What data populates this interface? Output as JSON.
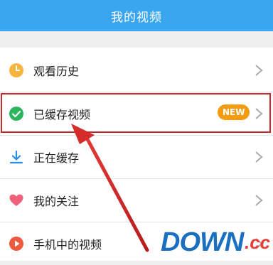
{
  "header": {
    "title": "我的视频"
  },
  "items": [
    {
      "label": "观看历史",
      "icon": "clock-icon",
      "color": "#f5b53f"
    },
    {
      "label": "已缓存视频",
      "icon": "check-circle-icon",
      "color": "#2db55d",
      "badge": "NEW",
      "badge_color": "#f39c12"
    },
    {
      "label": "正在缓存",
      "icon": "download-icon",
      "color": "#2a8fe0"
    },
    {
      "label": "我的关注",
      "icon": "heart-icon",
      "color": "#f0617c"
    },
    {
      "label": "手机中的视频",
      "icon": "play-circle-icon",
      "color": "#ef5a3c"
    }
  ],
  "annotation": {
    "highlight_color": "#c8282e"
  },
  "watermark": {
    "main": "DOWN",
    "suffix": ".cc"
  }
}
